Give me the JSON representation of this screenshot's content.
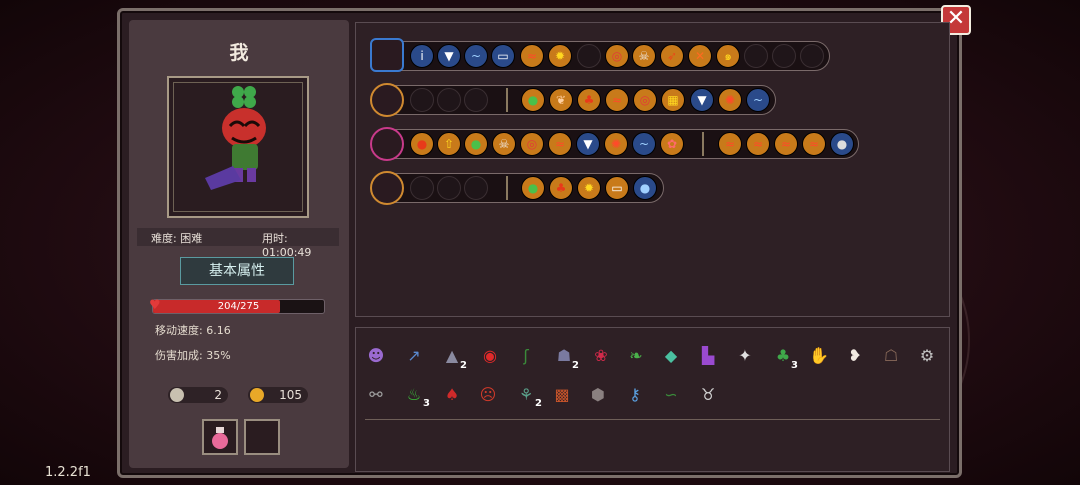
{
  "player": {
    "name": "我",
    "difficulty": "难度: 困难",
    "time": "用时: 01:00:49"
  },
  "stats": {
    "section_title": "基本属性",
    "hp_text": "204/275",
    "hp_fraction": 0.742,
    "move_speed": "移动速度: 6.16",
    "damage_bonus": "伤害加成: 35%"
  },
  "resources": {
    "keys": "2",
    "coins": "105"
  },
  "version": "1.2.2f1",
  "colors": {
    "hp": "#c82a2a",
    "accent_orange": "#d08a30",
    "accent_blue": "#3a7ad0",
    "close": "#c43838"
  },
  "equipment_rows": [
    {
      "weapon_icon": "satchel-icon",
      "slots": 17
    },
    {
      "weapon_icon": "magic-staff-icon",
      "slots": 12
    },
    {
      "weapon_icon": "spear-icon",
      "slots": 16
    },
    {
      "weapon_icon": "orb-icon",
      "slots": 8
    }
  ],
  "item_counts": {
    "shoe": "2",
    "shadow": "2",
    "clover": "3",
    "flame": "3",
    "sprout": "2"
  }
}
